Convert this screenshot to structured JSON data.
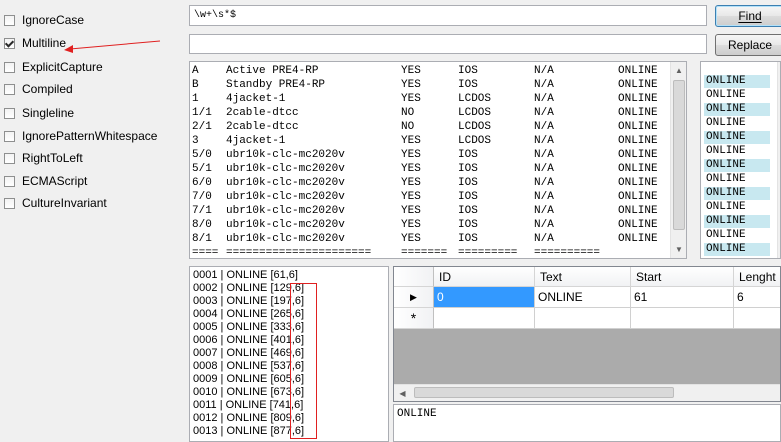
{
  "options": [
    {
      "label": "IgnoreCase",
      "checked": false
    },
    {
      "label": "Multiline",
      "checked": true
    },
    {
      "label": "ExplicitCapture",
      "checked": false
    },
    {
      "label": "Compiled",
      "checked": false
    },
    {
      "label": "Singleline",
      "checked": false
    },
    {
      "label": "IgnorePatternWhitespace",
      "checked": false
    },
    {
      "label": "RightToLeft",
      "checked": false
    },
    {
      "label": "ECMAScript",
      "checked": false
    },
    {
      "label": "CultureInvariant",
      "checked": false
    }
  ],
  "pattern": {
    "value": "\\w+\\s*$"
  },
  "replacement": {
    "value": ""
  },
  "buttons": {
    "find": "Find",
    "replace": "Replace"
  },
  "input_text": {
    "rows": [
      [
        "A",
        "Active PRE4-RP",
        "YES",
        "IOS",
        "N/A",
        "ONLINE"
      ],
      [
        "B",
        "Standby PRE4-RP",
        "YES",
        "IOS",
        "N/A",
        "ONLINE"
      ],
      [
        "1",
        "4jacket-1",
        "YES",
        "LCDOS",
        "N/A",
        "ONLINE"
      ],
      [
        "1/1",
        "2cable-dtcc",
        "NO",
        "LCDOS",
        "N/A",
        "ONLINE"
      ],
      [
        "2/1",
        "2cable-dtcc",
        "NO",
        "LCDOS",
        "N/A",
        "ONLINE"
      ],
      [
        "3",
        "4jacket-1",
        "YES",
        "LCDOS",
        "N/A",
        "ONLINE"
      ],
      [
        "5/0",
        "ubr10k-clc-mc2020v",
        "YES",
        "IOS",
        "N/A",
        "ONLINE"
      ],
      [
        "5/1",
        "ubr10k-clc-mc2020v",
        "YES",
        "IOS",
        "N/A",
        "ONLINE"
      ],
      [
        "6/0",
        "ubr10k-clc-mc2020v",
        "YES",
        "IOS",
        "N/A",
        "ONLINE"
      ],
      [
        "7/0",
        "ubr10k-clc-mc2020v",
        "YES",
        "IOS",
        "N/A",
        "ONLINE"
      ],
      [
        "7/1",
        "ubr10k-clc-mc2020v",
        "YES",
        "IOS",
        "N/A",
        "ONLINE"
      ],
      [
        "8/0",
        "ubr10k-clc-mc2020v",
        "YES",
        "IOS",
        "N/A",
        "ONLINE"
      ],
      [
        "8/1",
        "ubr10k-clc-mc2020v",
        "YES",
        "IOS",
        "N/A",
        "ONLINE"
      ],
      [
        "====",
        "======================",
        "=======",
        "=========",
        "==========",
        ""
      ]
    ]
  },
  "highlighted_matches": [
    "ONLINE",
    "ONLINE",
    "ONLINE",
    "ONLINE",
    "ONLINE",
    "ONLINE",
    "ONLINE",
    "ONLINE",
    "ONLINE",
    "ONLINE",
    "ONLINE",
    "ONLINE",
    "ONLINE"
  ],
  "match_list": [
    "0001 | ONLINE [61,6]",
    "0002 | ONLINE [129,6]",
    "0003 | ONLINE [197,6]",
    "0004 | ONLINE [265,6]",
    "0005 | ONLINE [333,6]",
    "0006 | ONLINE [401,6]",
    "0007 | ONLINE [469,6]",
    "0008 | ONLINE [537,6]",
    "0009 | ONLINE [605,6]",
    "0010 | ONLINE [673,6]",
    "0011 | ONLINE [741,6]",
    "0012 | ONLINE [809,6]",
    "0013 | ONLINE [877,6]"
  ],
  "groups_grid": {
    "columns": [
      "ID",
      "Text",
      "Start",
      "Lenght"
    ],
    "rows": [
      [
        "0",
        "ONLINE",
        "61",
        "6"
      ]
    ],
    "new_row_marker": "*",
    "current_row_marker": "▶"
  },
  "selected_text": "ONLINE",
  "colors": {
    "annotation": "#e02020",
    "highlight": "#c8e8f0",
    "selected_cell": "#3399ff"
  }
}
